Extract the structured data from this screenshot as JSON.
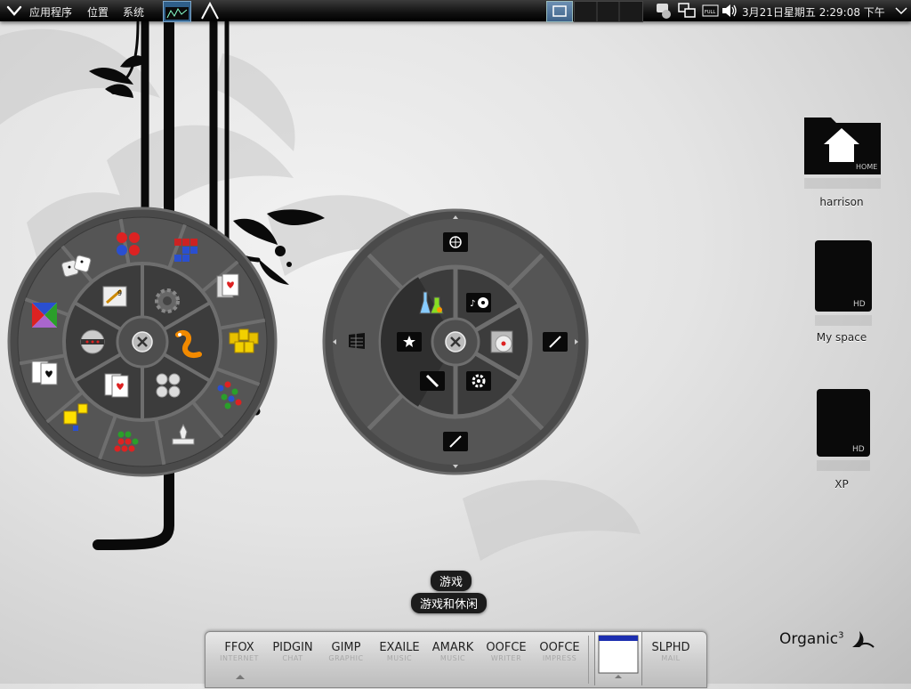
{
  "top_panel": {
    "menus": [
      "应用程序",
      "位置",
      "系统"
    ],
    "clock": "3月21日星期五  2:29:08 下午",
    "battery_label": "FULL"
  },
  "desktop_icons": [
    {
      "label": "harrison",
      "drive_text": "HOME"
    },
    {
      "label": "My space",
      "drive_text": "HD"
    },
    {
      "label": "XP",
      "drive_text": "HD"
    }
  ],
  "tooltips": {
    "category": "游戏",
    "description": "游戏和休闲"
  },
  "dock": {
    "items": [
      {
        "label": "FFOX",
        "sub": "INTERNET"
      },
      {
        "label": "PIDGIN",
        "sub": "CHAT"
      },
      {
        "label": "GIMP",
        "sub": "GRAPHIC"
      },
      {
        "label": "EXAILE",
        "sub": "MUSIC"
      },
      {
        "label": "AMARK",
        "sub": "MUSIC"
      },
      {
        "label": "OOFCE",
        "sub": "WRITER"
      },
      {
        "label": "OOFCE",
        "sub": "IMPRESS"
      },
      {
        "label": "SLPHD",
        "sub": "MAIL"
      }
    ]
  },
  "brand": {
    "name": "Organic",
    "sup": "3"
  },
  "icons": {
    "panel_menu": "chevron-down-icon",
    "close": "close-icon",
    "home": "home-icon"
  },
  "colors": {
    "panel": "#111111",
    "wheel": "#3a3a3a",
    "ring": "#5a5a5a"
  }
}
